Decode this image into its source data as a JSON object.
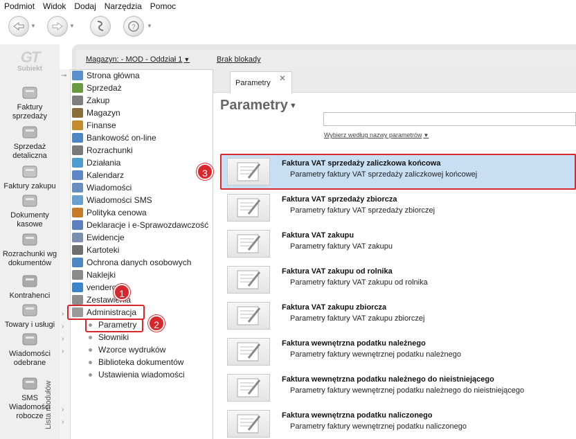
{
  "menu": [
    "Podmiot",
    "Widok",
    "Dodaj",
    "Narzędzia",
    "Pomoc"
  ],
  "logo": {
    "mark": "GT",
    "text": "Subiekt"
  },
  "left_nav": [
    {
      "label": "Faktury sprzedaży",
      "icon": "coins-icon"
    },
    {
      "label": "Sprzedaż detaliczna",
      "icon": "cash-register-icon"
    },
    {
      "label": "Faktury zakupu",
      "icon": "boxes-icon"
    },
    {
      "label": "Dokumenty kasowe",
      "icon": "cashbox-icon"
    },
    {
      "label": "Rozrachunki wg dokumentów",
      "icon": "settlement-icon"
    },
    {
      "label": "Kontrahenci",
      "icon": "person-icon"
    },
    {
      "label": "Towary i usługi",
      "icon": "goods-icon"
    },
    {
      "label": "Wiadomości odebrane",
      "icon": "mail-in-icon"
    },
    {
      "label": "SMS Wiadomości robocze",
      "icon": "sms-icon"
    }
  ],
  "top_links": {
    "magazyn": "Magazyn: - MOD - Oddział 1",
    "blokady": "Brak blokady"
  },
  "modules_label": "Lista modułów",
  "modules": [
    "Strona główna",
    "Sprzedaż",
    "Zakup",
    "Magazyn",
    "Finanse",
    "Bankowość on-line",
    "Rozrachunki",
    "Działania",
    "Kalendarz",
    "Wiadomości",
    "Wiadomości SMS",
    "Polityka cenowa",
    "Deklaracje i e-Sprawozdawczość",
    "Ewidencje",
    "Kartoteki",
    "Ochrona danych osobowych",
    "Naklejki",
    "vendero",
    "Zestawienia",
    "Administracja"
  ],
  "submodules": [
    "Parametry",
    "Słowniki",
    "Wzorce wydruków",
    "Biblioteka dokumentów",
    "Ustawienia wiadomości"
  ],
  "tab": {
    "label": "Parametry",
    "close": "✕"
  },
  "page_title": "Parametry",
  "search_hint": "Wybierz według nazwy parametrów",
  "rows": [
    {
      "title": "Faktura VAT sprzedaży zaliczkowa końcowa",
      "desc": "Parametry faktury VAT sprzedaży zaliczkowej końcowej"
    },
    {
      "title": "Faktura VAT sprzedaży zbiorcza",
      "desc": "Parametry faktury VAT sprzedaży zbiorczej"
    },
    {
      "title": "Faktura VAT zakupu",
      "desc": "Parametry faktury VAT zakupu"
    },
    {
      "title": "Faktura VAT zakupu od rolnika",
      "desc": "Parametry faktury VAT zakupu od rolnika"
    },
    {
      "title": "Faktura VAT zakupu zbiorcza",
      "desc": "Parametry faktury VAT zakupu zbiorczej"
    },
    {
      "title": "Faktura wewnętrzna podatku należnego",
      "desc": "Parametry faktury wewnętrznej podatku należnego"
    },
    {
      "title": "Faktura wewnętrzna podatku należnego do nieistniejącego",
      "desc": "Parametry faktury wewnętrznej podatku należnego do nieistniejącego"
    },
    {
      "title": "Faktura wewnętrzna podatku naliczonego",
      "desc": "Parametry faktury wewnętrznej podatku naliczonego"
    }
  ],
  "badges": [
    "1",
    "2",
    "3"
  ],
  "colors": {
    "highlight": "#d9262c",
    "selected_row": "#c7def3"
  }
}
